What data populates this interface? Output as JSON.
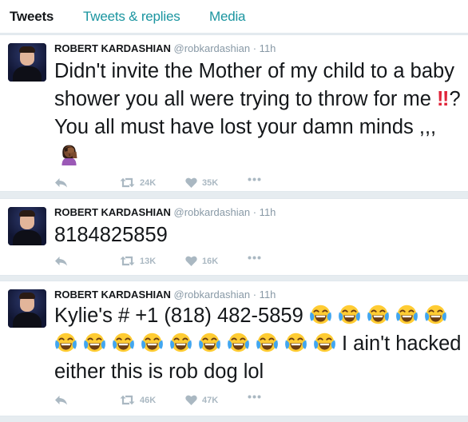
{
  "tabs": [
    "Tweets",
    "Tweets & replies",
    "Media"
  ],
  "colors": {
    "accent": "#1b95a0",
    "muted": "#8899a6",
    "action": "#aab8c2",
    "alert": "#e0243a"
  },
  "icons": {
    "reply": "reply-icon",
    "retweet": "retweet-icon",
    "like": "heart-icon",
    "more": "more-icon",
    "laugh": "face-with-tears-of-joy-emoji",
    "facepalm": "woman-facepalming-emoji",
    "bangbang": "double-exclamation-emoji"
  },
  "tweets": [
    {
      "name": "ROBERT KARDASHIAN",
      "handle": "@robkardashian",
      "time": "· 11h",
      "text_a": "Didn't invite the Mother of my child to a baby shower you all were trying to throw for me",
      "text_b": "? You all must have lost your damn minds ,,,",
      "bangbang": "‼",
      "retweets": "24K",
      "likes": "35K"
    },
    {
      "name": "ROBERT KARDASHIAN",
      "handle": "@robkardashian",
      "time": "· 11h",
      "text": "8184825859",
      "retweets": "13K",
      "likes": "16K"
    },
    {
      "name": "ROBERT KARDASHIAN",
      "handle": "@robkardashian",
      "time": "· 11h",
      "text_a": "Kylie's # +1 (818) 482-5859",
      "text_b": "I ain't hacked either this is rob dog lol",
      "laugh_count": 15,
      "retweets": "46K",
      "likes": "47K"
    }
  ]
}
